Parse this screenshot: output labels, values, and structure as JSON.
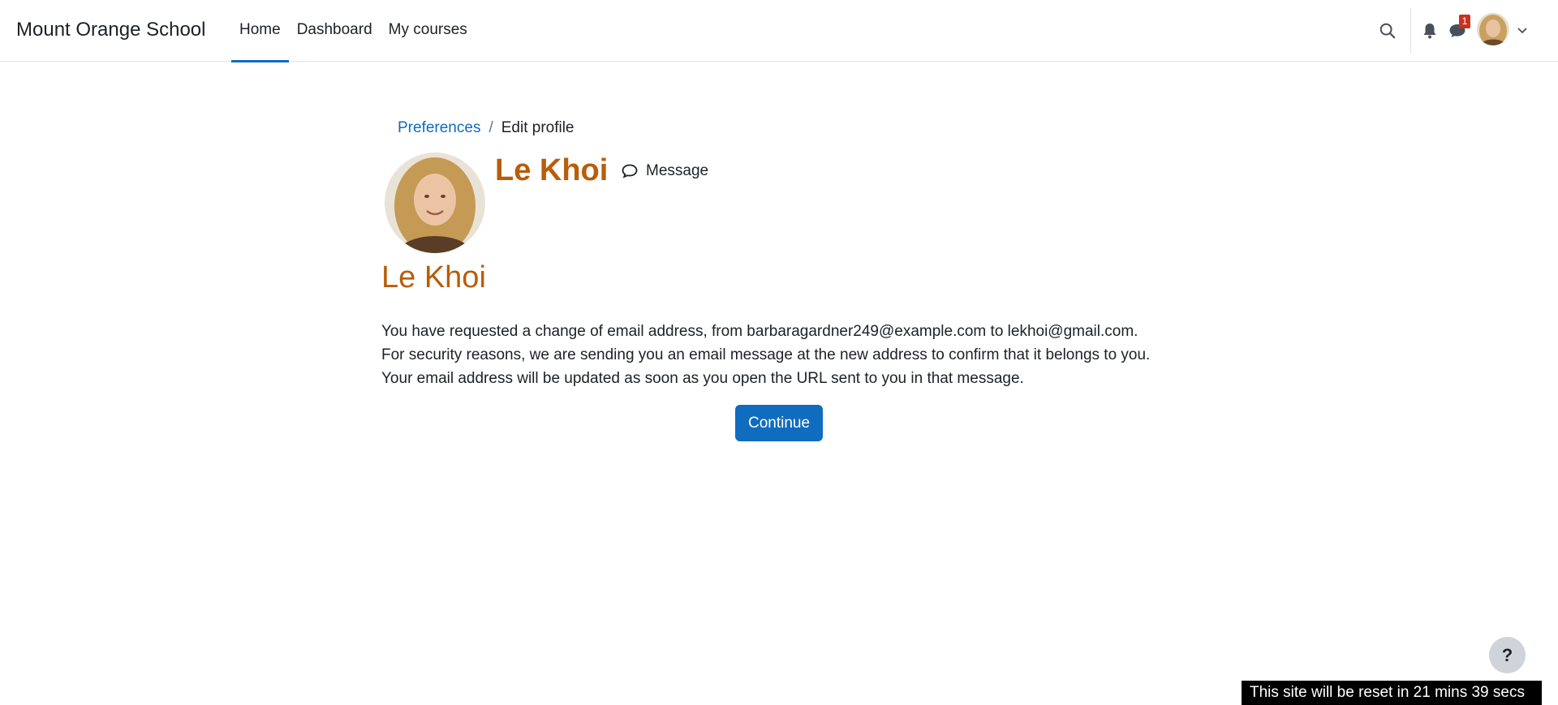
{
  "navbar": {
    "brand": "Mount Orange School",
    "links": [
      {
        "label": "Home",
        "active": true
      },
      {
        "label": "Dashboard",
        "active": false
      },
      {
        "label": "My courses",
        "active": false
      }
    ],
    "icons": [
      "search-icon",
      "bell-icon",
      "chat-icon",
      "chevron-down-icon"
    ],
    "message_badge": "1"
  },
  "breadcrumb": {
    "items": [
      "Preferences",
      "Edit profile"
    ]
  },
  "profile": {
    "name": "Le Khoi",
    "message_label": "Message"
  },
  "page_title": "Le Khoi",
  "notice": {
    "lines": [
      "You have requested a change of email address, from barbaragardner249@example.com to lekhoi@gmail.com.",
      "For security reasons, we are sending you an email message at the new address to confirm that it belongs to you.",
      "Your email address will be updated as soon as you open the URL sent to you in that message."
    ]
  },
  "continue_label": "Continue",
  "help_label": "?",
  "reset_banner": "This site will be reset in 21 mins 39 secs",
  "colors": {
    "accent": "#0f6cbf",
    "name": "#b85d0a",
    "badge": "#ca3120"
  }
}
